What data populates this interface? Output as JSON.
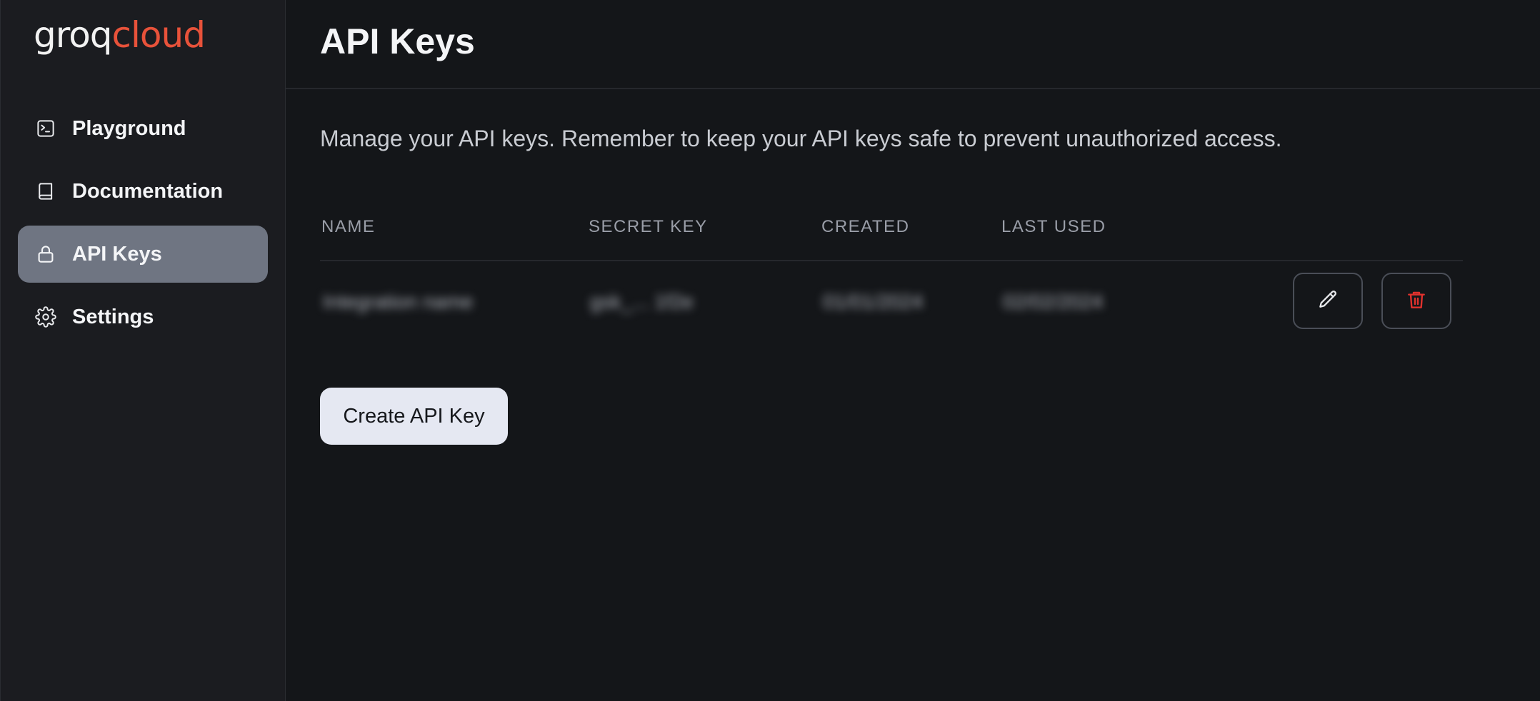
{
  "brand": {
    "part1": "groq",
    "part2": "cloud",
    "accent_color": "#e8523a"
  },
  "sidebar": {
    "items": [
      {
        "label": "Playground",
        "icon": "terminal-icon",
        "active": false
      },
      {
        "label": "Documentation",
        "icon": "book-icon",
        "active": false
      },
      {
        "label": "API Keys",
        "icon": "lock-icon",
        "active": true
      },
      {
        "label": "Settings",
        "icon": "gear-icon",
        "active": false
      }
    ]
  },
  "page": {
    "title": "API Keys",
    "description": "Manage your API keys. Remember to keep your API keys safe to prevent unauthorized access."
  },
  "table": {
    "columns": [
      "NAME",
      "SECRET KEY",
      "CREATED",
      "LAST USED"
    ],
    "rows": [
      {
        "name": "Integration name",
        "secret_key": "gsk_... 1f2e",
        "created": "01/01/2024",
        "last_used": "02/02/2024"
      }
    ],
    "actions": {
      "edit_icon": "pencil-icon",
      "delete_icon": "trash-icon",
      "delete_color": "#e0312d"
    }
  },
  "create_button": {
    "label": "Create API Key"
  }
}
